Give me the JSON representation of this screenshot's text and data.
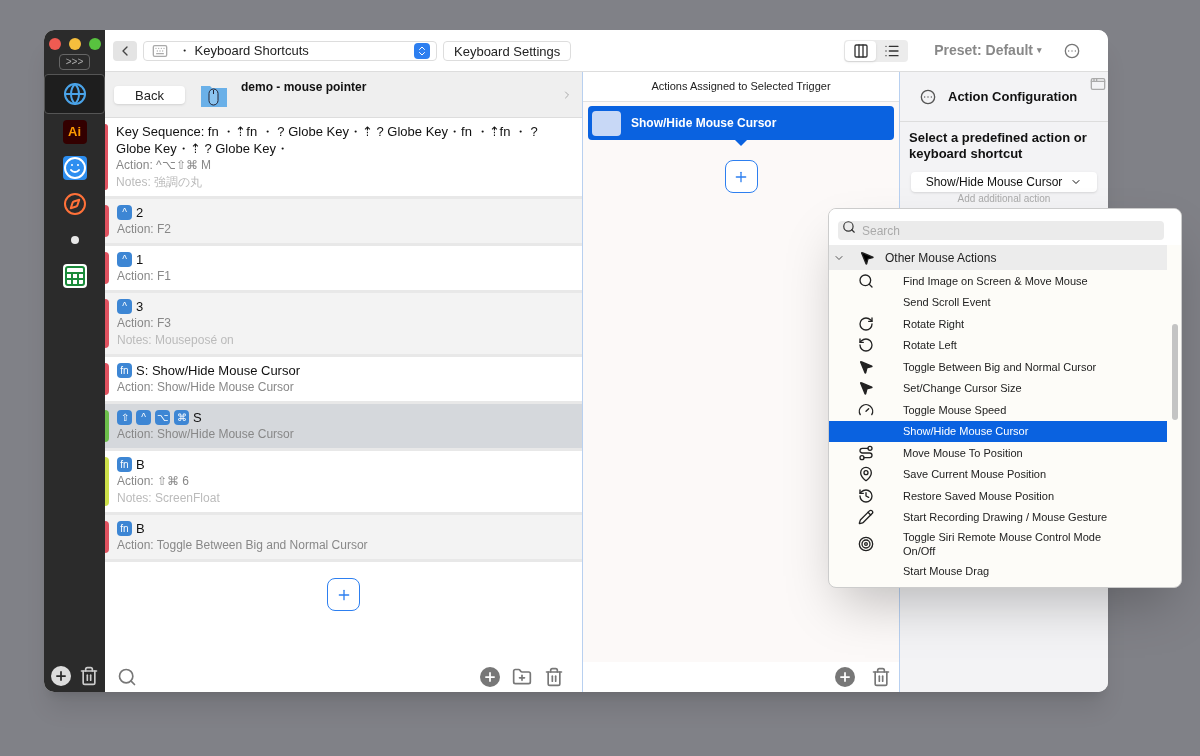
{
  "sidebar": {
    "expand_button": ">>>",
    "apps": [
      {
        "kind": "globe",
        "selected": true
      },
      {
        "kind": "illustrator",
        "label": "Ai",
        "selected": false
      },
      {
        "kind": "finder",
        "selected": false
      },
      {
        "kind": "firefox",
        "selected": false
      },
      {
        "kind": "dot",
        "selected": false
      },
      {
        "kind": "spreadsheet",
        "selected": false
      }
    ]
  },
  "toolbar": {
    "path": "・ Keyboard Shortcuts",
    "settings_button": "Keyboard Settings",
    "views": [
      {
        "kind": "columns",
        "selected": true
      },
      {
        "kind": "list",
        "selected": false
      }
    ],
    "preset": "Preset: Default",
    "preset_caret": "▾"
  },
  "group": {
    "back_button": "Back",
    "title": "demo - mouse pointer"
  },
  "triggers": [
    {
      "trigger": "Key Sequence: fn ・⇡fn ・ ? Globe Key・⇡ ? Globe Key・fn ・⇡fn ・ ? Globe Key・⇡ ? Globe Key・",
      "action": "Action: ^⌥⇧⌘ M",
      "notes": "Notes: 強調の丸",
      "color": "#e05260",
      "selected": false
    },
    {
      "keys": [
        "^"
      ],
      "trigger": "2",
      "action": "Action:  F2",
      "color": "#e05260",
      "selected": false
    },
    {
      "keys": [
        "^"
      ],
      "trigger": "1",
      "action": "Action:  F1",
      "color": "#e05260",
      "selected": false
    },
    {
      "keys": [
        "^"
      ],
      "trigger": "3",
      "action": "Action:  F3",
      "notes": "Notes: Mouseposé on",
      "color": "#e05260",
      "selected": false
    },
    {
      "keys": [
        "fn"
      ],
      "trigger": "S: Show/Hide Mouse Cursor",
      "action": "Action: Show/Hide Mouse Cursor",
      "color": "#e05260",
      "selected": false
    },
    {
      "keys": [
        "⇧",
        "^",
        "⌥",
        "⌘"
      ],
      "trigger": "S",
      "action": "Action: Show/Hide Mouse Cursor",
      "color": "#6cbf4a",
      "selected": true
    },
    {
      "keys": [
        "fn"
      ],
      "trigger": "B",
      "action": "Action: ⇧⌘ 6",
      "notes": "Notes: ScreenFloat",
      "color": "#cde04a",
      "selected": false
    },
    {
      "keys": [
        "fn"
      ],
      "trigger": "B",
      "action": "Action: Toggle Between Big and Normal Cursor",
      "color": "#e05260",
      "selected": false
    }
  ],
  "actions_panel": {
    "title": "Actions Assigned to Selected Trigger",
    "actions": [
      {
        "label": "Show/Hide Mouse Cursor",
        "selected": true
      }
    ]
  },
  "config_panel": {
    "title": "Action Configuration",
    "prompt": "Select a predefined action or keyboard shortcut",
    "dropdown": "Show/Hide Mouse Cursor",
    "hint": "Add additional action"
  },
  "action_menu": {
    "placeholder": "Search",
    "category": "Other Mouse Actions",
    "items": [
      {
        "kind": "magnifier",
        "label": "Find Image on Screen & Move Mouse",
        "selected": false
      },
      {
        "kind": "none",
        "label": "Send Scroll Event",
        "selected": false
      },
      {
        "kind": "rotate-right",
        "label": "Rotate Right",
        "selected": false
      },
      {
        "kind": "rotate-left",
        "label": "Rotate Left",
        "selected": false
      },
      {
        "kind": "cursor",
        "label": "Toggle Between Big and Normal Cursor",
        "selected": false
      },
      {
        "kind": "cursor",
        "label": "Set/Change Cursor Size",
        "selected": false
      },
      {
        "kind": "gauge",
        "label": "Toggle Mouse Speed",
        "selected": false
      },
      {
        "kind": "none",
        "label": "Show/Hide Mouse Cursor",
        "selected": true
      },
      {
        "kind": "path",
        "label": "Move Mouse To Position",
        "selected": false
      },
      {
        "kind": "pin",
        "label": "Save Current Mouse Position",
        "selected": false
      },
      {
        "kind": "history",
        "label": "Restore Saved Mouse Position",
        "selected": false
      },
      {
        "kind": "pencil",
        "label": "Start Recording Drawing / Mouse Gesture",
        "selected": false
      },
      {
        "kind": "target",
        "label": "Toggle Siri Remote Mouse Control Mode On/Off",
        "selected": false
      },
      {
        "kind": "none",
        "label": "Start Mouse Drag",
        "selected": false
      }
    ]
  }
}
